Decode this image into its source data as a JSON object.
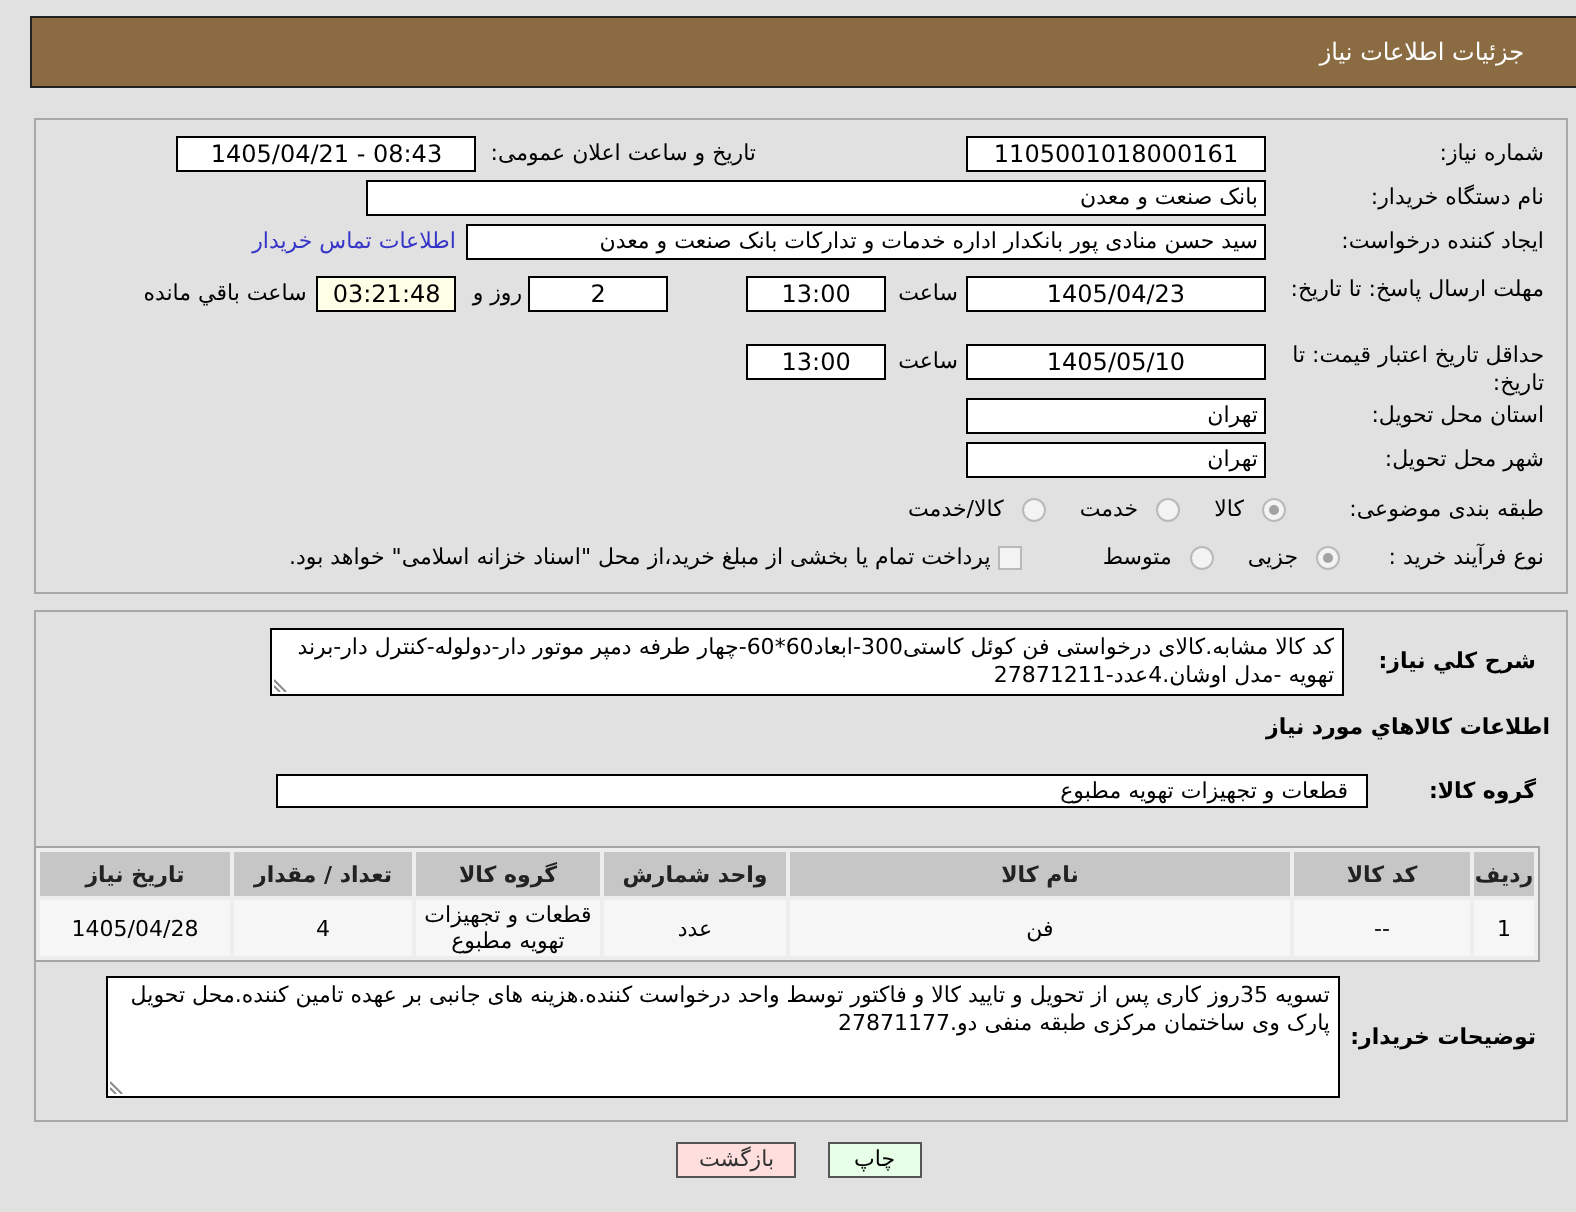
{
  "header": {
    "title": "جزئیات اطلاعات نیاز"
  },
  "need_number": {
    "label": "شماره نیاز:",
    "value": "1105001018000161"
  },
  "announce_datetime": {
    "label": "تاریخ و ساعت اعلان عمومی:",
    "value": "1405/04/21 - 08:43"
  },
  "buyer_org": {
    "label": "نام دستگاه خریدار:",
    "value": "بانک صنعت و معدن"
  },
  "requester": {
    "label": "ایجاد کننده درخواست:",
    "value": "سید حسن منادی پور بانکدار اداره خدمات و تدارکات بانک صنعت و معدن",
    "contact_link": "اطلاعات تماس خریدار"
  },
  "reply_deadline": {
    "label": "مهلت ارسال پاسخ: تا تاریخ:",
    "date": "1405/04/23",
    "time_label": "ساعت",
    "time": "13:00",
    "days": "2",
    "days_label": "روز و",
    "remaining": "03:21:48",
    "remaining_label": "ساعت باقي مانده"
  },
  "price_validity": {
    "label": "حداقل تاریخ اعتبار قیمت: تا تاریخ:",
    "date": "1405/05/10",
    "time_label": "ساعت",
    "time": "13:00"
  },
  "delivery_province": {
    "label": "استان محل تحویل:",
    "value": "تهران"
  },
  "delivery_city": {
    "label": "شهر محل تحویل:",
    "value": "تهران"
  },
  "subject_category": {
    "label": "طبقه بندی موضوعی:",
    "options": [
      {
        "label": "کالا",
        "selected": true
      },
      {
        "label": "خدمت",
        "selected": false
      },
      {
        "label": "کالا/خدمت",
        "selected": false
      }
    ]
  },
  "purchase_process": {
    "label": "نوع فرآیند خرید :",
    "options": [
      {
        "label": "جزیی",
        "selected": true
      },
      {
        "label": "متوسط",
        "selected": false
      }
    ],
    "treasury_payment": {
      "label": "پرداخت تمام یا بخشی از مبلغ خرید،از محل \"اسناد خزانه اسلامی\" خواهد بود.",
      "checked": false
    }
  },
  "summary": {
    "label": "شرح کلي نیاز:",
    "text": "کد کالا مشابه.کالای درخواستی فن کوئل کاستی300-ابعاد60*60-چهار طرفه دمپر موتور دار-دولوله-کنترل دار-برند تهویه -مدل اوشان.4عدد-27871211"
  },
  "goods": {
    "heading": "اطلاعات کالاهاي مورد نیاز",
    "group": {
      "label": "گروه کالا:",
      "value": "قطعات و تجهیزات تهویه مطبوع"
    },
    "table": {
      "columns": [
        "ردیف",
        "کد کالا",
        "نام کالا",
        "واحد شمارش",
        "گروه کالا",
        "تعداد / مقدار",
        "تاریخ نیاز"
      ],
      "rows": [
        [
          "1",
          "--",
          "فن",
          "عدد",
          "قطعات و تجهیزات تهویه مطبوع",
          "4",
          "1405/04/28"
        ]
      ]
    }
  },
  "buyer_notes": {
    "label": "توضیحات خریدار:",
    "text": "تسویه 35روز کاری پس از تحویل و تایید کالا و فاکتور توسط واحد درخواست کننده.هزینه های جانبی بر عهده تامین کننده.محل تحویل پارک وی ساختمان مرکزی طبقه منفی دو.27871177"
  },
  "buttons": [
    {
      "label": "چاپ",
      "kind": "print"
    },
    {
      "label": "بازگشت",
      "kind": "back"
    }
  ]
}
